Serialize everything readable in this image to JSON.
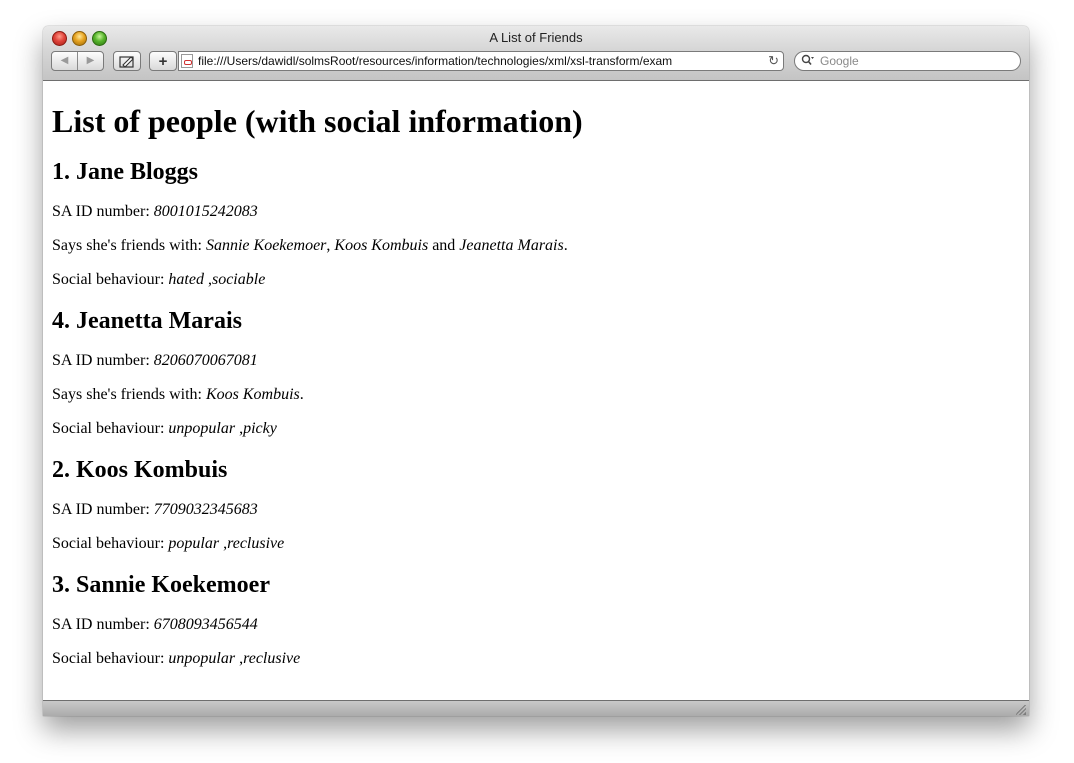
{
  "window": {
    "title": "A List of Friends"
  },
  "toolbar": {
    "back_label": "◀",
    "forward_label": "▶",
    "plus_label": "+",
    "address": "file:///Users/dawidl/solmsRoot/resources/information/technologies/xml/xsl-transform/exam",
    "reload_icon": "reload-icon",
    "search_placeholder": "Google"
  },
  "page": {
    "heading": "List of people (with social information)",
    "labels": {
      "id": "SA ID number:",
      "friends": "Says she's friends with:",
      "social": "Social behaviour:",
      "and": "and",
      "comma": ",",
      "period": "."
    },
    "people": [
      {
        "title": "1. Jane Bloggs",
        "id_number": "8001015242083",
        "friends": [
          "Sannie Koekemoer",
          "Koos Kombuis",
          "Jeanetta Marais"
        ],
        "behaviours": [
          "hated",
          "sociable"
        ]
      },
      {
        "title": "4. Jeanetta Marais",
        "id_number": "8206070067081",
        "friends": [
          "Koos Kombuis"
        ],
        "behaviours": [
          "unpopular",
          "picky"
        ]
      },
      {
        "title": "2. Koos Kombuis",
        "id_number": "7709032345683",
        "behaviours": [
          "popular",
          "reclusive"
        ]
      },
      {
        "title": "3. Sannie Koekemoer",
        "id_number": "6708093456544",
        "behaviours": [
          "unpopular",
          "reclusive"
        ]
      }
    ]
  }
}
